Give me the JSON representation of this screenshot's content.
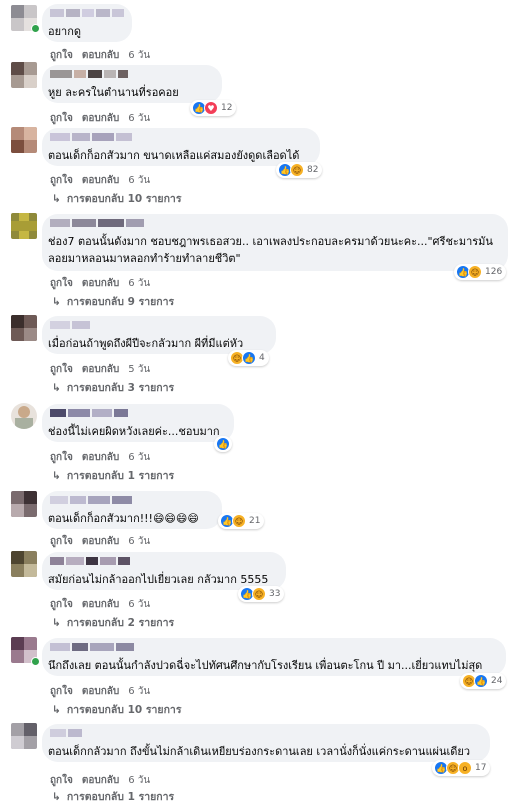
{
  "action_labels": {
    "like": "ถูกใจ",
    "reply": "ตอบกลับ"
  },
  "comments": [
    {
      "text": [
        "อยากดู"
      ],
      "time": "6 วัน",
      "reaction": null,
      "replies": null
    },
    {
      "text": [
        "หูย ละครในตำนานที่รอคอย"
      ],
      "time": "6 วัน",
      "reaction": {
        "icons": [
          "like-icon",
          "love-icon"
        ],
        "count": "12"
      },
      "replies": null
    },
    {
      "text": [
        "ตอนเด็กก็อกสัวมาก ขนาดเหลือแค่สมองยังดูดเลือดได้"
      ],
      "time": "6 วัน",
      "reaction": {
        "icons": [
          "like-icon",
          "haha-icon"
        ],
        "count": "82"
      },
      "replies": "การตอบกลับ 10 รายการ"
    },
    {
      "text": [
        "ช่อง7 ตอนนั้นดังมาก ชอบชฎาพรเธอสวย.. เอาเพลงประกอบละครมาด้วยนะคะ...\"ศรีชะมารมัน",
        "ลอยมาหลอนมาหลอกทำร้ายทำลายชีวิต\""
      ],
      "time": "6 วัน",
      "reaction": {
        "icons": [
          "like-icon",
          "haha-icon"
        ],
        "count": "126"
      },
      "replies": "การตอบกลับ 9 รายการ"
    },
    {
      "text": [
        "เมื่อก่อนถ้าพูดถึงผีปีจะกลัวมาก ผีที่มีแต่หัว"
      ],
      "time": "5 วัน",
      "reaction": {
        "icons": [
          "haha-icon",
          "like-icon"
        ],
        "count": "4"
      },
      "replies": "การตอบกลับ 3 รายการ"
    },
    {
      "text": [
        "ช่องนี้ไม่เคยผิดหวังเลยค่ะ...ชอบมาก"
      ],
      "time": "6 วัน",
      "reaction": {
        "icons": [
          "like-icon"
        ],
        "count": ""
      },
      "replies": "การตอบกลับ 1 รายการ"
    },
    {
      "text": [
        "ตอนเด็กก็อกสัวมาก!!!😄😄😄😄"
      ],
      "time": "6 วัน",
      "reaction": {
        "icons": [
          "like-icon",
          "haha-icon"
        ],
        "count": "21"
      },
      "replies": null
    },
    {
      "text": [
        "สมัยก่อนไม่กล้าออกไปเยี่ยวเลย กลัวมาก 5555"
      ],
      "time": "6 วัน",
      "reaction": {
        "icons": [
          "like-icon",
          "haha-icon"
        ],
        "count": "33"
      },
      "replies": "การตอบกลับ 2 รายการ"
    },
    {
      "text": [
        "นึกถึงเลย ตอนนั้นกำลังปวดฉี่จะไปทัศนศึกษากับโรงเรียน เพื่อนตะโกน ปี มา...เยี่ยวแทบไม่สุด"
      ],
      "time": "6 วัน",
      "reaction": {
        "icons": [
          "haha-icon",
          "like-icon"
        ],
        "count": "24"
      },
      "replies": "การตอบกลับ 10 รายการ"
    },
    {
      "text": [
        "ตอนเด็กกลัวมาก ถึงขั้นไม่กล้าเดินเหยียบร่องกระดานเลย เวลานั่งก็นั่งแค่กระดานแผ่นเดียว"
      ],
      "time": "6 วัน",
      "reaction": {
        "icons": [
          "like-icon",
          "haha-icon",
          "wow-icon"
        ],
        "count": "17"
      },
      "replies": "การตอบกลับ 1 รายการ"
    }
  ]
}
